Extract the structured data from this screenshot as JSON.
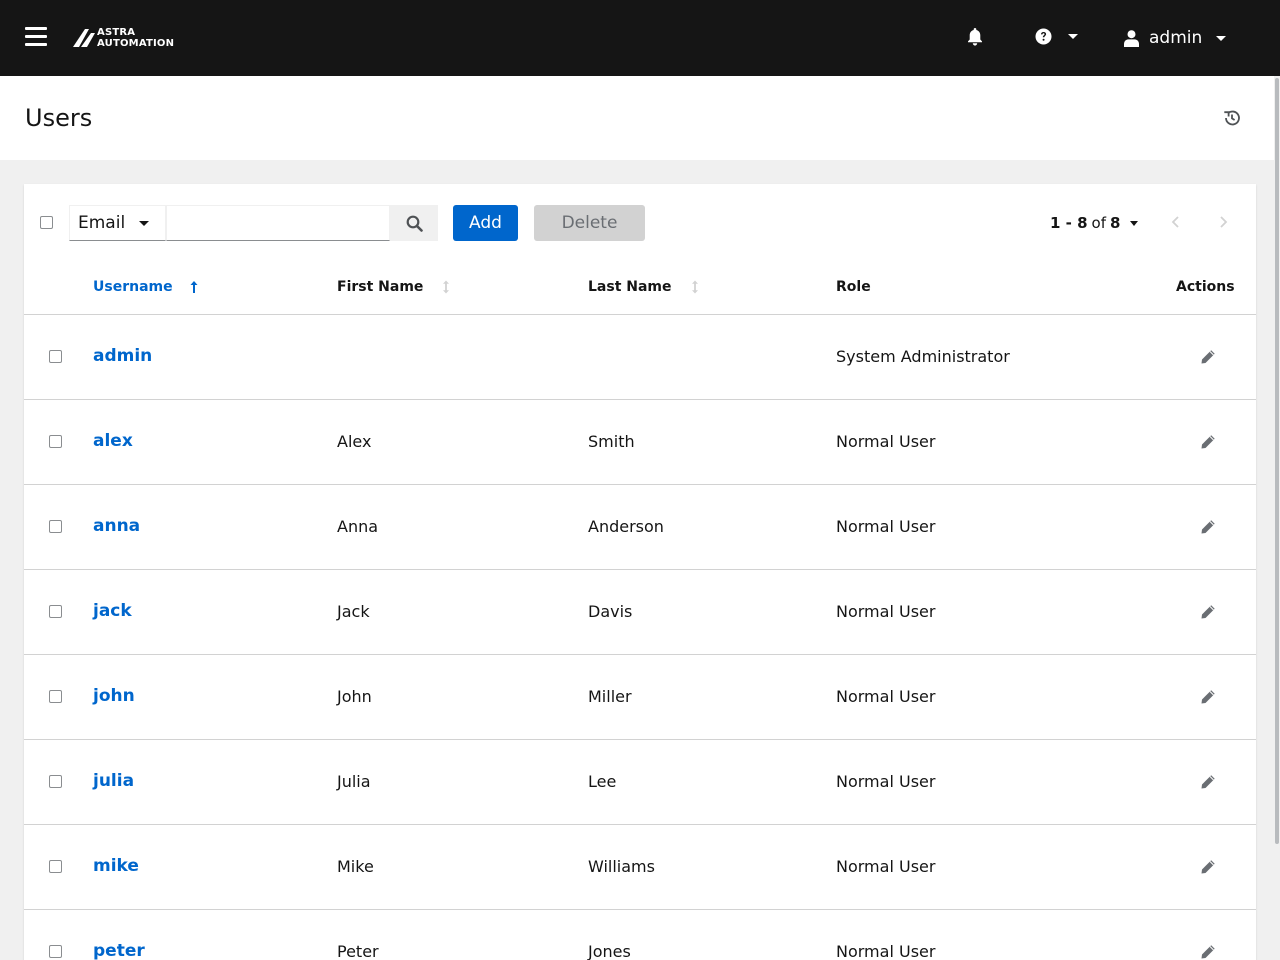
{
  "header": {
    "logo_line1": "ASTRA",
    "logo_line2": "AUTOMATION",
    "user_name": "admin",
    "icons": [
      "menu-icon",
      "bell-icon",
      "help-icon",
      "user-icon"
    ]
  },
  "page": {
    "title": "Users"
  },
  "toolbar": {
    "filter_field": "Email",
    "search_value": "",
    "add_label": "Add",
    "delete_label": "Delete",
    "pagination_range": "1 - 8",
    "pagination_of": "of",
    "pagination_total": "8"
  },
  "table": {
    "columns": {
      "username": "Username",
      "first_name": "First Name",
      "last_name": "Last Name",
      "role": "Role",
      "actions": "Actions"
    },
    "sort": {
      "column": "username",
      "direction": "ascending"
    },
    "rows": [
      {
        "username": "admin",
        "first_name": "",
        "last_name": "",
        "role": "System Administrator"
      },
      {
        "username": "alex",
        "first_name": "Alex",
        "last_name": "Smith",
        "role": "Normal User"
      },
      {
        "username": "anna",
        "first_name": "Anna",
        "last_name": "Anderson",
        "role": "Normal User"
      },
      {
        "username": "jack",
        "first_name": "Jack",
        "last_name": "Davis",
        "role": "Normal User"
      },
      {
        "username": "john",
        "first_name": "John",
        "last_name": "Miller",
        "role": "Normal User"
      },
      {
        "username": "julia",
        "first_name": "Julia",
        "last_name": "Lee",
        "role": "Normal User"
      },
      {
        "username": "mike",
        "first_name": "Mike",
        "last_name": "Williams",
        "role": "Normal User"
      },
      {
        "username": "peter",
        "first_name": "Peter",
        "last_name": "Jones",
        "role": "Normal User"
      }
    ]
  },
  "colors": {
    "masthead": "#151515",
    "link": "#0066cc",
    "primary_button": "#0066cc",
    "disabled_button": "#d2d2d2"
  }
}
